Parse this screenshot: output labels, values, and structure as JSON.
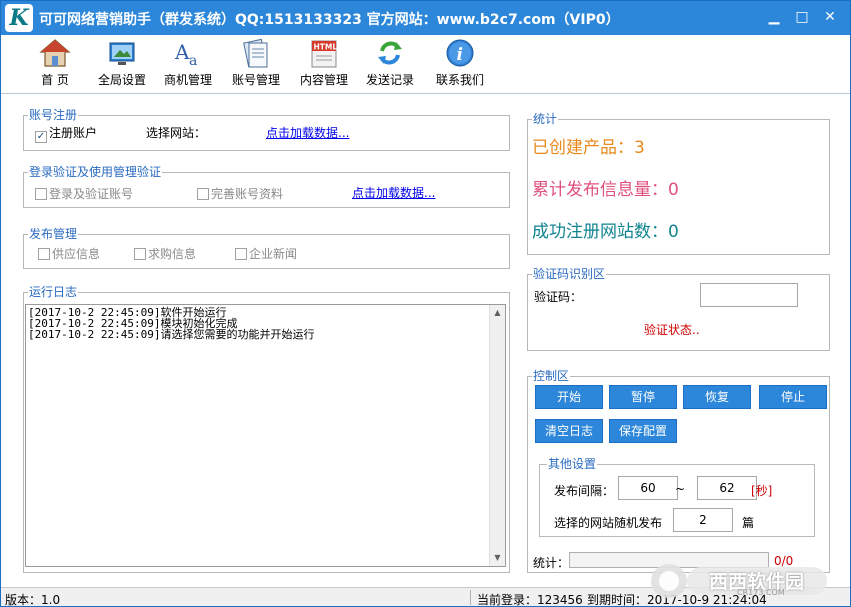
{
  "window": {
    "title": "可可网络营销助手（群发系统）QQ:1513133323 官方网站：www.b2c7.com（VIP0）",
    "logo_letter": "K",
    "minimize": "▁",
    "maximize": "□",
    "close": "✕"
  },
  "toolbar": [
    {
      "label": "首 页",
      "icon": "home-icon"
    },
    {
      "label": "全局设置",
      "icon": "settings-icon"
    },
    {
      "label": "商机管理",
      "icon": "font-icon"
    },
    {
      "label": "账号管理",
      "icon": "account-icon"
    },
    {
      "label": "内容管理",
      "icon": "html-icon"
    },
    {
      "label": "发送记录",
      "icon": "refresh-icon"
    },
    {
      "label": "联系我们",
      "icon": "info-icon"
    }
  ],
  "account_reg": {
    "title": "账号注册",
    "checkbox": "注册账户",
    "site_label": "选择网站：",
    "load_link": "点击加载数据..."
  },
  "login_verify": {
    "title": "登录验证及使用管理验证",
    "check1": "登录及验证账号",
    "check2": "完善账号资料",
    "load_link": "点击加载数据..."
  },
  "publish": {
    "title": "发布管理",
    "check1": "供应信息",
    "check2": "求购信息",
    "check3": "企业新闻"
  },
  "log": {
    "title": "运行日志",
    "text": "[2017-10-2 22:45:09]软件开始运行\n[2017-10-2 22:45:09]模块初始化完成\n[2017-10-2 22:45:09]请选择您需要的功能并开始运行"
  },
  "stats": {
    "title": "统计",
    "products": "已创建产品：3",
    "published": "累计发布信息量：0",
    "registered": "成功注册网站数：0",
    "colors": {
      "products": "#e8891c",
      "published": "#e0517c",
      "registered": "#108590"
    }
  },
  "captcha": {
    "title": "验证码识别区",
    "label": "验证码：",
    "value": "",
    "status": "验证状态..",
    "status_color": "#cc0000"
  },
  "control": {
    "title": "控制区",
    "start": "开始",
    "pause": "暂停",
    "resume": "恢复",
    "stop": "停止",
    "clear_log": "清空日志",
    "save_config": "保存配置",
    "other": {
      "title": "其他设置",
      "interval_label": "发布间隔：",
      "interval_min": "60",
      "tilde": "~",
      "interval_max": "62",
      "unit": "[秒]",
      "random_label": "选择的网站随机发布",
      "random_count": "2",
      "random_unit": "篇"
    },
    "progress_label": "统计：",
    "progress_text": "0/0",
    "progress_value": 0
  },
  "status": {
    "version": "版本：1.0",
    "login": "当前登录：123456",
    "expiry": "到期时间：2017-10-9 21:24:04"
  },
  "watermark": {
    "text": "西西软件园",
    "sub": "CR173.COM"
  },
  "colors": {
    "accent": "#2c86d9",
    "group_title": "#2a6bc1"
  }
}
